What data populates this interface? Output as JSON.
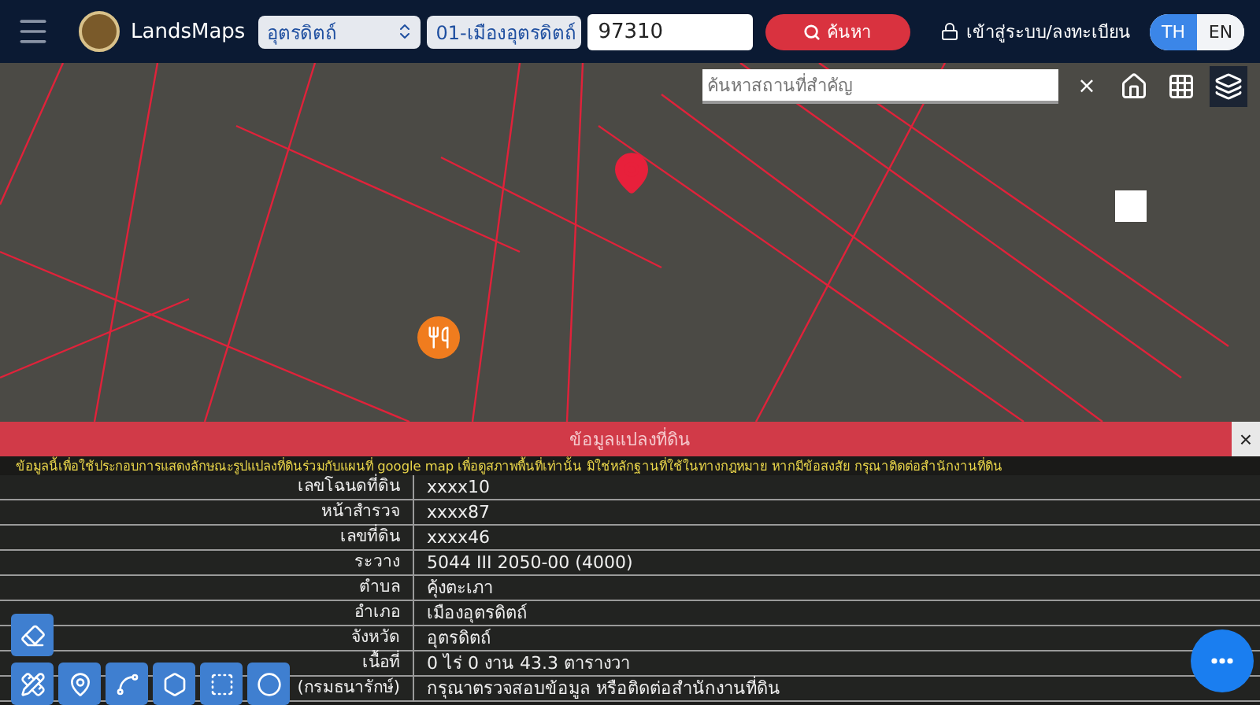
{
  "header": {
    "app_name": "LandsMaps",
    "province": {
      "value": "อุตรดิตถ์"
    },
    "district": {
      "value": "01-เมืองอุตรดิตถ์"
    },
    "parcel_number": {
      "value": "97310"
    },
    "search_button": "ค้นหา",
    "login_link": "เข้าสู่ระบบ/ลงทะเบียน",
    "languages": [
      {
        "label": "TH",
        "selected": true
      },
      {
        "label": "EN",
        "selected": false
      }
    ]
  },
  "map": {
    "place_search": {
      "placeholder": "ค้นหาสถานที่สำคัญ"
    },
    "close_label": "×"
  },
  "info_panel": {
    "title": "ข้อมูลแปลงที่ดิน",
    "close_label": "×",
    "disclaimer": "ข้อมูลนี้เพื่อใช้ประกอบการแสดงลักษณะรูปแปลงที่ดินร่วมกับแผนที่ google map เพื่อดูสภาพพื้นที่เท่านั้น มิใช่หลักฐานที่ใช้ในทางกฎหมาย หากมีข้อสงสัย กรุณาติดต่อสำนักงานที่ดิน",
    "rows": [
      {
        "label": "เลขโฉนดที่ดิน",
        "value": "xxxx10"
      },
      {
        "label": "หน้าสำรวจ",
        "value": "xxxx87"
      },
      {
        "label": "เลขที่ดิน",
        "value": "xxxx46"
      },
      {
        "label": "ระวาง",
        "value": "5044 III 2050-00 (4000)"
      },
      {
        "label": "ตำบล",
        "value": "คุ้งตะเภา"
      },
      {
        "label": "อำเภอ",
        "value": "เมืองอุตรดิตถ์"
      },
      {
        "label": "จังหวัด",
        "value": "อุตรดิตถ์"
      },
      {
        "label": "เนื้อที่",
        "value": "0 ไร่ 0 งาน 43.3 ตารางวา"
      },
      {
        "label": "(กรมธนารักษ์)",
        "value": "กรุณาตรวจสอบข้อมูล หรือติดต่อสำนักงานที่ดิน"
      }
    ]
  }
}
